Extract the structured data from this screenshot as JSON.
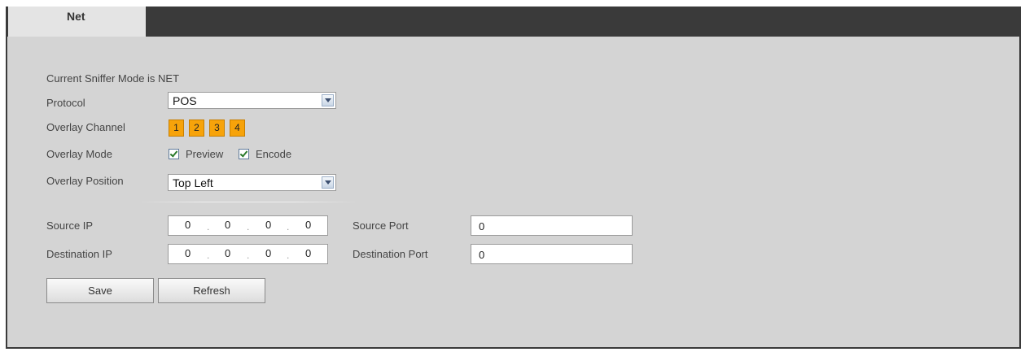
{
  "tabs": [
    {
      "label": "Net"
    }
  ],
  "status_text": "Current Sniffer Mode is NET",
  "protocol": {
    "label": "Protocol",
    "value": "POS"
  },
  "overlay_channel": {
    "label": "Overlay Channel",
    "channels": [
      "1",
      "2",
      "3",
      "4"
    ]
  },
  "overlay_mode": {
    "label": "Overlay Mode",
    "options": [
      {
        "label": "Preview",
        "checked": true
      },
      {
        "label": "Encode",
        "checked": true
      }
    ]
  },
  "overlay_position": {
    "label": "Overlay Position",
    "value": "Top Left"
  },
  "source_ip": {
    "label": "Source IP",
    "octets": [
      "0",
      "0",
      "0",
      "0"
    ]
  },
  "destination_ip": {
    "label": "Destination IP",
    "octets": [
      "0",
      "0",
      "0",
      "0"
    ]
  },
  "source_port": {
    "label": "Source Port",
    "value": "0"
  },
  "destination_port": {
    "label": "Destination Port",
    "value": "0"
  },
  "buttons": {
    "save": "Save",
    "refresh": "Refresh"
  },
  "colors": {
    "accent_channel": "#f7a30a",
    "panel_bg": "#d4d4d4",
    "header_bg": "#3a3a3a"
  }
}
